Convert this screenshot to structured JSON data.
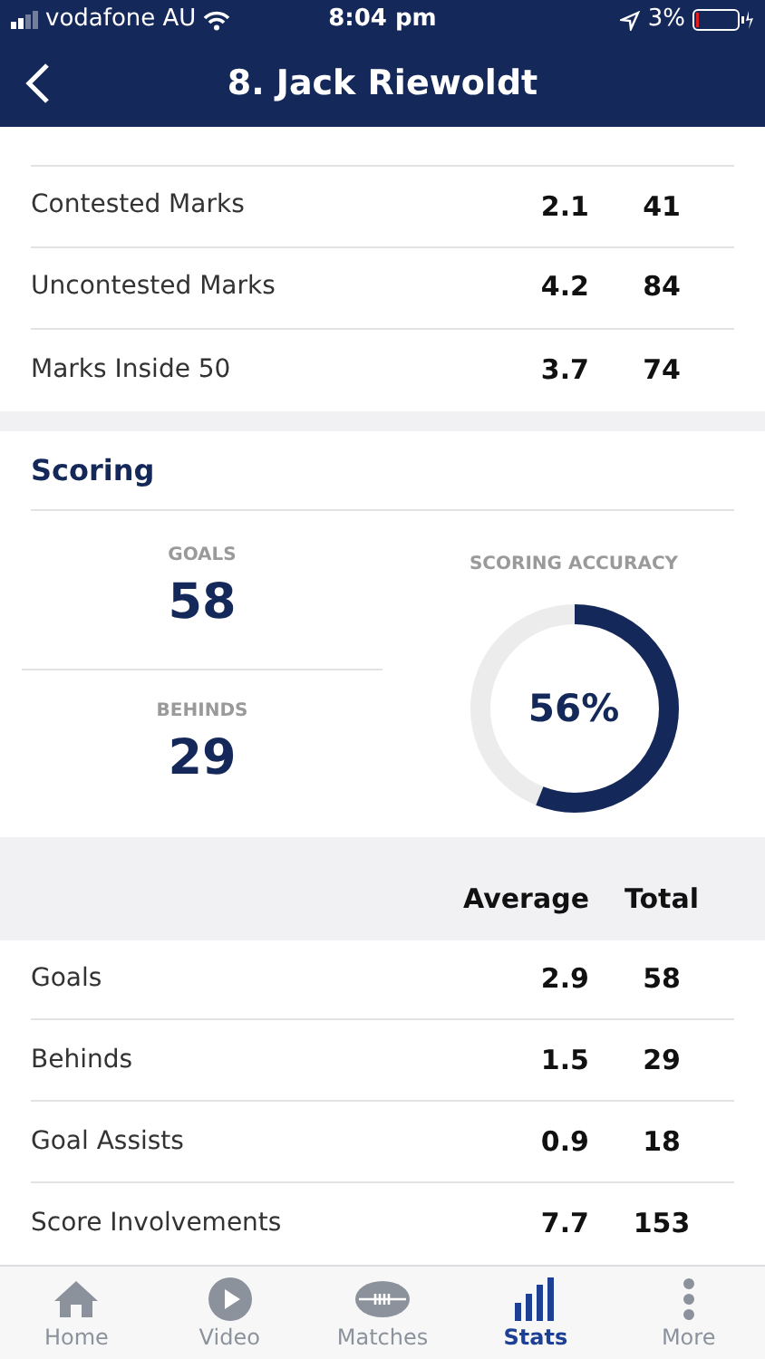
{
  "status_bar": {
    "carrier": "vodafone AU",
    "time": "8:04 pm",
    "battery": "3%"
  },
  "header": {
    "title": "8. Jack Riewoldt"
  },
  "marks_rows": [
    {
      "label": "Contested Marks",
      "average": "2.1",
      "total": "41"
    },
    {
      "label": "Uncontested Marks",
      "average": "4.2",
      "total": "84"
    },
    {
      "label": "Marks Inside 50",
      "average": "3.7",
      "total": "74"
    }
  ],
  "scoring": {
    "title": "Scoring",
    "goals_label": "GOALS",
    "goals": "58",
    "behinds_label": "BEHINDS",
    "behinds": "29",
    "accuracy_label": "SCORING ACCURACY",
    "accuracy": "56%",
    "level": 0.56
  },
  "table": {
    "columns": [
      "Average",
      "Total"
    ],
    "rows": [
      {
        "label": "Goals",
        "average": "2.9",
        "total": "58"
      },
      {
        "label": "Behinds",
        "average": "1.5",
        "total": "29"
      },
      {
        "label": "Goal Assists",
        "average": "0.9",
        "total": "18"
      },
      {
        "label": "Score Involvements",
        "average": "7.7",
        "total": "153"
      }
    ]
  },
  "tabs": [
    {
      "label": "Home",
      "kind": "home",
      "selected": false
    },
    {
      "label": "Video",
      "kind": "video",
      "selected": false
    },
    {
      "label": "Matches",
      "kind": "matches",
      "selected": false
    },
    {
      "label": "Stats",
      "kind": "stats",
      "selected": true
    },
    {
      "label": "More",
      "kind": "more",
      "selected": false
    }
  ]
}
